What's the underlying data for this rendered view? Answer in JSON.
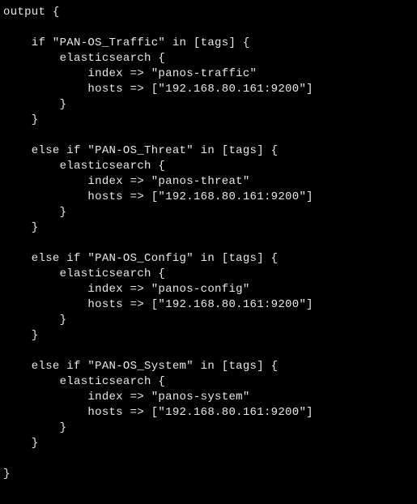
{
  "code": {
    "lines": [
      "output {",
      "",
      "    if \"PAN-OS_Traffic\" in [tags] {",
      "        elasticsearch {",
      "            index => \"panos-traffic\"",
      "            hosts => [\"192.168.80.161:9200\"]",
      "        }",
      "    }",
      "",
      "    else if \"PAN-OS_Threat\" in [tags] {",
      "        elasticsearch {",
      "            index => \"panos-threat\"",
      "            hosts => [\"192.168.80.161:9200\"]",
      "        }",
      "    }",
      "",
      "    else if \"PAN-OS_Config\" in [tags] {",
      "        elasticsearch {",
      "            index => \"panos-config\"",
      "            hosts => [\"192.168.80.161:9200\"]",
      "        }",
      "    }",
      "",
      "    else if \"PAN-OS_System\" in [tags] {",
      "        elasticsearch {",
      "            index => \"panos-system\"",
      "            hosts => [\"192.168.80.161:9200\"]",
      "        }",
      "    }",
      "",
      "}"
    ]
  }
}
